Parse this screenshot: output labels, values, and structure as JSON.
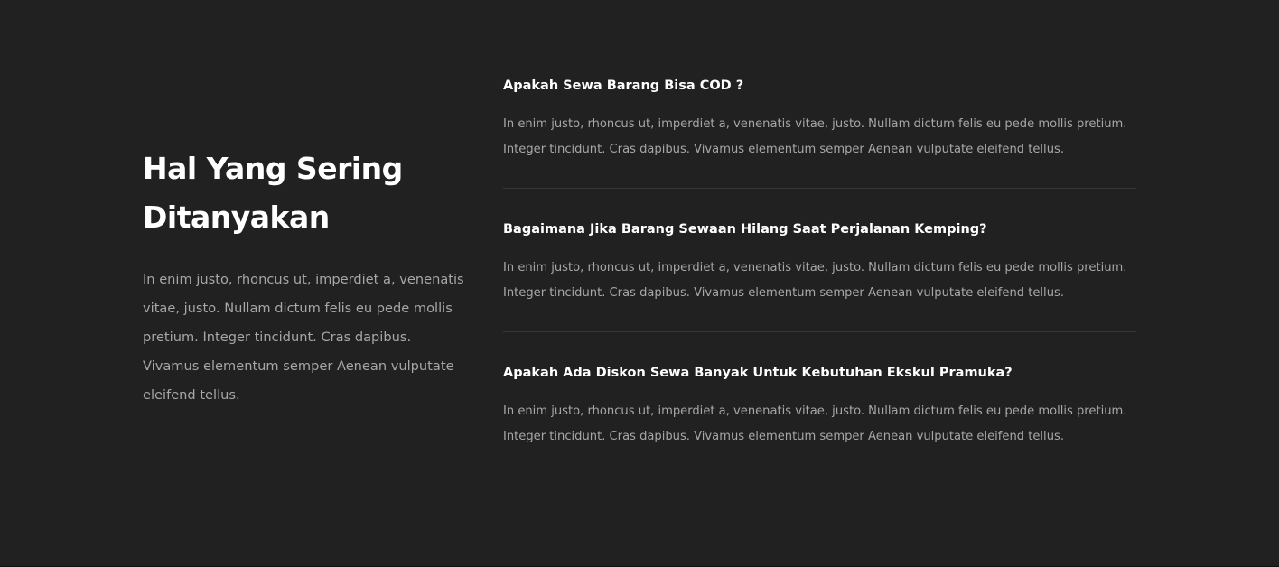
{
  "intro": {
    "title": "Hal Yang Sering Ditanyakan",
    "text": "In enim justo, rhoncus ut, imperdiet a, venenatis vitae, justo. Nullam dictum felis eu pede mollis pretium. Integer tincidunt. Cras dapibus. Vivamus elementum semper Aenean vulputate eleifend tellus."
  },
  "faq": [
    {
      "question": "Apakah Sewa Barang Bisa COD ?",
      "answer": "In enim justo, rhoncus ut, imperdiet a, venenatis vitae, justo. Nullam dictum felis eu pede mollis pretium. Integer tincidunt. Cras dapibus. Vivamus elementum semper Aenean vulputate eleifend tellus."
    },
    {
      "question": "Bagaimana Jika Barang Sewaan Hilang Saat Perjalanan Kemping?",
      "answer": "In enim justo, rhoncus ut, imperdiet a, venenatis vitae, justo. Nullam dictum felis eu pede mollis pretium. Integer tincidunt. Cras dapibus. Vivamus elementum semper Aenean vulputate eleifend tellus."
    },
    {
      "question": "Apakah Ada Diskon Sewa Banyak Untuk Kebutuhan Ekskul Pramuka?",
      "answer": "In enim justo, rhoncus ut, imperdiet a, venenatis vitae, justo. Nullam dictum felis eu pede mollis pretium. Integer tincidunt. Cras dapibus. Vivamus elementum semper Aenean vulputate eleifend tellus."
    }
  ],
  "colors": {
    "background": "#212121",
    "heading": "#ffffff",
    "body_text": "#a7a7a7",
    "divider": "#363636"
  }
}
